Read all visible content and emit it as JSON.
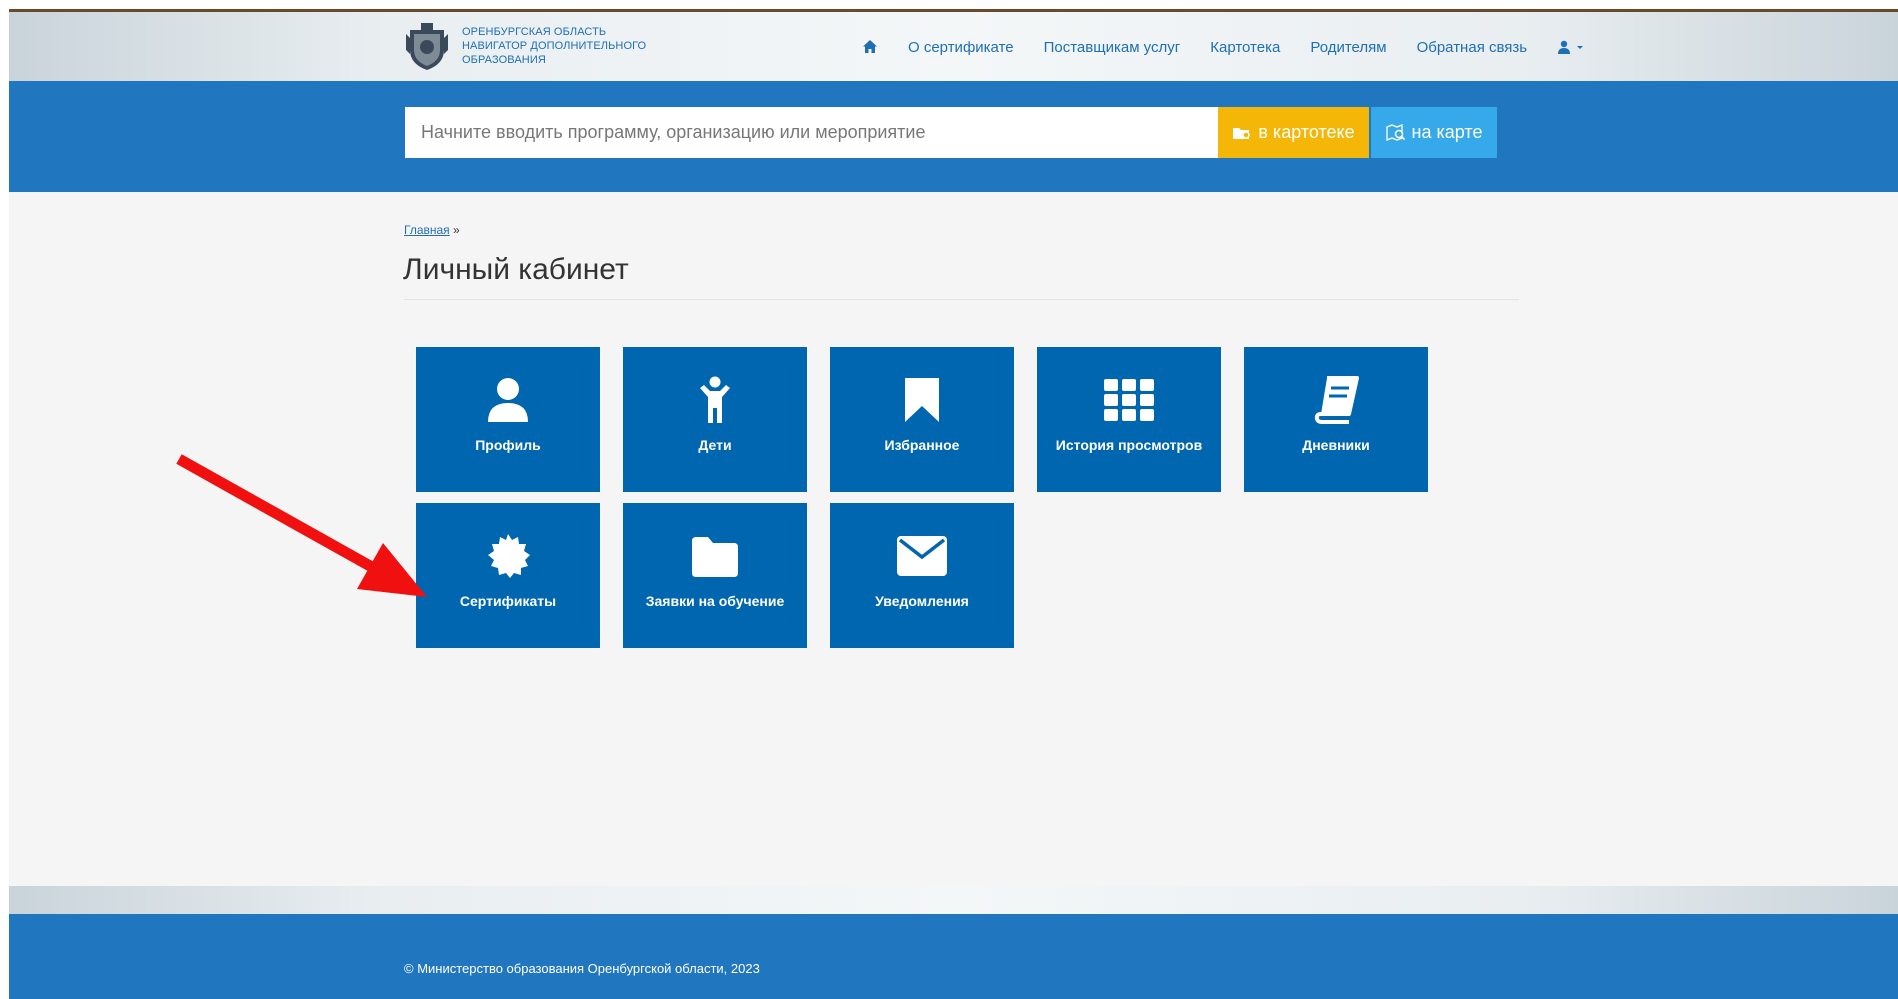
{
  "header": {
    "brand_lines": [
      "ОРЕНБУРГСКАЯ ОБЛАСТЬ",
      "НАВИГАТОР ДОПОЛНИТЕЛЬНОГО",
      "ОБРАЗОВАНИЯ"
    ],
    "nav": [
      {
        "icon": "home-icon"
      },
      {
        "label": "О сертификате"
      },
      {
        "label": "Поставщикам услуг"
      },
      {
        "label": "Картотека"
      },
      {
        "label": "Родителям"
      },
      {
        "label": "Обратная связь"
      },
      {
        "icon": "user-icon"
      }
    ]
  },
  "search": {
    "placeholder": "Начните вводить программу, организацию или мероприятие",
    "catalog_button": "в картотеке",
    "map_button": "на карте"
  },
  "breadcrumb": {
    "home": "Главная",
    "separator": "»"
  },
  "page": {
    "title": "Личный кабинет"
  },
  "tiles": [
    {
      "label": "Профиль",
      "icon": "user-icon"
    },
    {
      "label": "Дети",
      "icon": "child-icon"
    },
    {
      "label": "Избранное",
      "icon": "bookmark-icon"
    },
    {
      "label": "История просмотров",
      "icon": "grid-icon"
    },
    {
      "label": "Дневники",
      "icon": "book-icon"
    },
    {
      "label": "Сертификаты",
      "icon": "certificate-icon"
    },
    {
      "label": "Заявки на обучение",
      "icon": "folder-icon"
    },
    {
      "label": "Уведомления",
      "icon": "envelope-icon"
    }
  ],
  "footer": {
    "copyright": "© Министерство образования Оренбургской области, 2023"
  },
  "colors": {
    "primary": "#2176c0",
    "tile": "#0066b0",
    "catalog_button": "#f5b707",
    "map_button": "#36a9ea",
    "arrow": "#f01010",
    "link": "#1f6fb5"
  }
}
